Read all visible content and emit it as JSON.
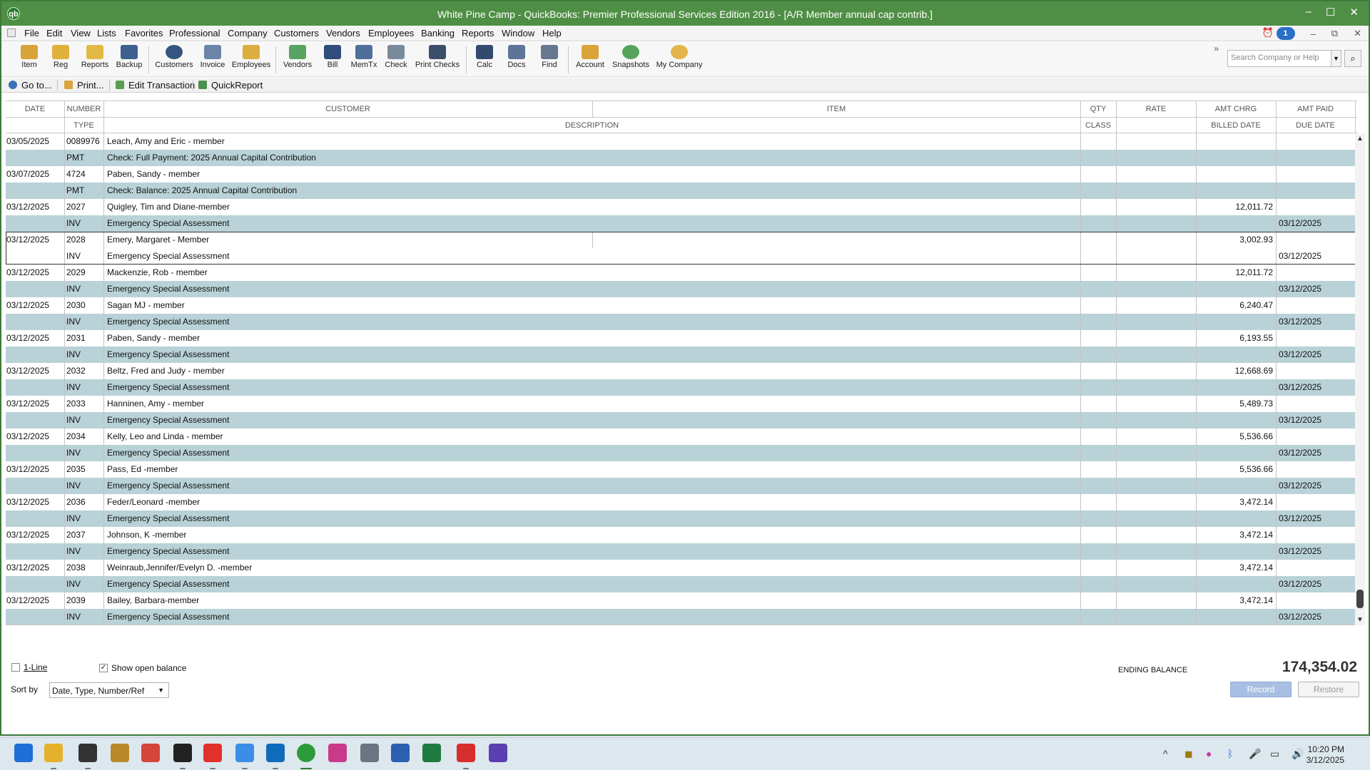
{
  "window": {
    "title": "White Pine Camp  - QuickBooks: Premier Professional Services Edition 2016 - [A/R Member annual cap contrib.]",
    "logo": "qb",
    "controls": [
      "–",
      "☐",
      "✕"
    ]
  },
  "menu": {
    "items": [
      "File",
      "Edit",
      "View",
      "Lists",
      "Favorites",
      "Professional",
      "Company",
      "Customers",
      "Vendors",
      "Employees",
      "Banking",
      "Reports",
      "Window",
      "Help"
    ],
    "reminder_count": "1",
    "mdi_controls": [
      "–",
      "⧉",
      "✕"
    ]
  },
  "icon_bar": {
    "items": [
      "Item",
      "Reg",
      "Reports",
      "Backup",
      "Customers",
      "Invoice",
      "Employees",
      "Vendors",
      "Bill",
      "MemTx",
      "Check",
      "Print Checks",
      "Calc",
      "Docs",
      "Find",
      "Account",
      "Snapshots",
      "My Company"
    ],
    "more": "»",
    "search_placeholder": "Search Company or Help"
  },
  "action_bar": {
    "goto": "Go to...",
    "print": "Print...",
    "edit_transaction": "Edit Transaction",
    "quickreport": "QuickReport"
  },
  "register": {
    "headers_row1": [
      "DATE",
      "NUMBER",
      "CUSTOMER",
      "ITEM",
      "QTY",
      "RATE",
      "AMT CHRG",
      "AMT PAID"
    ],
    "headers_row2": [
      "TYPE",
      "DESCRIPTION",
      "CLASS",
      "BILLED DATE",
      "DUE DATE"
    ],
    "transactions": [
      {
        "date": "03/05/2025",
        "number": "0089976",
        "customer": "Leach, Amy and Eric - member",
        "type": "PMT",
        "description": "Check: Full Payment: 2025 Annual Capital Contribution",
        "amt_chrg": "",
        "due_date": ""
      },
      {
        "date": "03/07/2025",
        "number": "4724",
        "customer": "Paben, Sandy - member",
        "type": "PMT",
        "description": "Check: Balance: 2025 Annual Capital Contribution",
        "amt_chrg": "",
        "due_date": ""
      },
      {
        "date": "03/12/2025",
        "number": "2027",
        "customer": "Quigley, Tim and Diane-member",
        "type": "INV",
        "description": "Emergency Special Assessment",
        "amt_chrg": "12,011.72",
        "due_date": "03/12/2025"
      },
      {
        "date": "03/12/2025",
        "number": "2028",
        "customer": "Emery, Margaret - Member",
        "type": "INV",
        "description": "Emergency Special Assessment",
        "amt_chrg": "3,002.93",
        "due_date": "03/12/2025"
      },
      {
        "date": "03/12/2025",
        "number": "2029",
        "customer": "Mackenzie, Rob - member",
        "type": "INV",
        "description": "Emergency Special Assessment",
        "amt_chrg": "12,011.72",
        "due_date": "03/12/2025"
      },
      {
        "date": "03/12/2025",
        "number": "2030",
        "customer": "Sagan MJ - member",
        "type": "INV",
        "description": "Emergency Special Assessment",
        "amt_chrg": "6,240.47",
        "due_date": "03/12/2025"
      },
      {
        "date": "03/12/2025",
        "number": "2031",
        "customer": "Paben, Sandy - member",
        "type": "INV",
        "description": "Emergency Special Assessment",
        "amt_chrg": "6,193.55",
        "due_date": "03/12/2025"
      },
      {
        "date": "03/12/2025",
        "number": "2032",
        "customer": "Beltz, Fred and Judy - member",
        "type": "INV",
        "description": "Emergency Special Assessment",
        "amt_chrg": "12,668.69",
        "due_date": "03/12/2025"
      },
      {
        "date": "03/12/2025",
        "number": "2033",
        "customer": "Hanninen, Amy - member",
        "type": "INV",
        "description": "Emergency Special Assessment",
        "amt_chrg": "5,489.73",
        "due_date": "03/12/2025"
      },
      {
        "date": "03/12/2025",
        "number": "2034",
        "customer": "Kelly, Leo and Linda - member",
        "type": "INV",
        "description": "Emergency Special Assessment",
        "amt_chrg": "5,536.66",
        "due_date": "03/12/2025"
      },
      {
        "date": "03/12/2025",
        "number": "2035",
        "customer": "Pass, Ed -member",
        "type": "INV",
        "description": "Emergency Special Assessment",
        "amt_chrg": "5,536.66",
        "due_date": "03/12/2025"
      },
      {
        "date": "03/12/2025",
        "number": "2036",
        "customer": "Feder/Leonard -member",
        "type": "INV",
        "description": "Emergency Special Assessment",
        "amt_chrg": "3,472.14",
        "due_date": "03/12/2025"
      },
      {
        "date": "03/12/2025",
        "number": "2037",
        "customer": "Johnson, K -member",
        "type": "INV",
        "description": "Emergency Special Assessment",
        "amt_chrg": "3,472.14",
        "due_date": "03/12/2025"
      },
      {
        "date": "03/12/2025",
        "number": "2038",
        "customer": "Weinraub,Jennifer/Evelyn D. -member",
        "type": "INV",
        "description": "Emergency Special Assessment",
        "amt_chrg": "3,472.14",
        "due_date": "03/12/2025"
      },
      {
        "date": "03/12/2025",
        "number": "2039",
        "customer": "Bailey, Barbara-member",
        "type": "INV",
        "description": "Emergency Special Assessment",
        "amt_chrg": "3,472.14",
        "due_date": "03/12/2025"
      }
    ],
    "selected_index": 3
  },
  "footer": {
    "one_line_label": "1-Line",
    "one_line_checked": false,
    "show_open_balance_label": "Show open balance",
    "show_open_balance_checked": true,
    "sort_by_label": "Sort by",
    "sort_by_value": "Date, Type, Number/Ref",
    "ending_balance_label": "ENDING BALANCE",
    "ending_balance": "174,354.02",
    "record_label": "Record",
    "restore_label": "Restore"
  },
  "taskbar": {
    "apps": [
      "start-icon",
      "file-explorer-icon",
      "chrome-alt-icon",
      "app-icon",
      "stack-icon",
      "app-red-icon",
      "vivaldi-icon",
      "chrome-icon",
      "outlook-icon",
      "quickbooks-icon",
      "snip-icon",
      "printer-icon",
      "word-icon",
      "excel-icon",
      "acrobat-icon",
      "app-purple-icon"
    ],
    "tray": [
      "^",
      "◼",
      "●",
      "ᛒ",
      "🎤",
      "▭",
      "🔊"
    ],
    "time": "10:20 PM",
    "date": "3/12/2025"
  },
  "colors": {
    "title_bar": "#4f8f45",
    "row_alt": "#b9d2d7",
    "taskbar": "#dde7ee"
  }
}
